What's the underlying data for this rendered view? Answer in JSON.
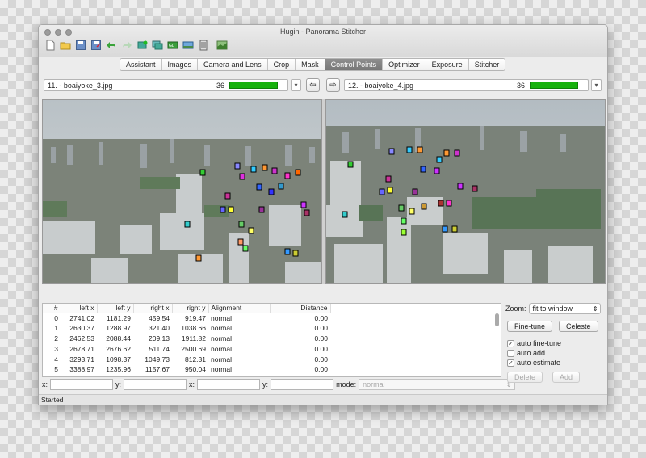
{
  "window": {
    "title": "Hugin - Panorama Stitcher"
  },
  "toolbar": {
    "icons": [
      "new-icon",
      "open-icon",
      "save-icon",
      "save-as-icon",
      "undo-icon",
      "redo-icon",
      "add-images-icon",
      "add-series-icon",
      "align-icon",
      "preview-icon",
      "fast-preview-icon",
      "layout-icon",
      "stitch-icon"
    ]
  },
  "tabs": [
    {
      "label": "Assistant",
      "active": false
    },
    {
      "label": "Images",
      "active": false
    },
    {
      "label": "Camera and Lens",
      "active": false
    },
    {
      "label": "Crop",
      "active": false
    },
    {
      "label": "Mask",
      "active": false
    },
    {
      "label": "Control Points",
      "active": true
    },
    {
      "label": "Optimizer",
      "active": false
    },
    {
      "label": "Exposure",
      "active": false
    },
    {
      "label": "Stitcher",
      "active": false
    }
  ],
  "left_image": {
    "name": "11. - boaiyoke_3.jpg",
    "count": "36"
  },
  "right_image": {
    "name": "12. - boaiyoke_4.jpg",
    "count": "36"
  },
  "table": {
    "headers": [
      "#",
      "left x",
      "left y",
      "right x",
      "right y",
      "Alignment",
      "Distance"
    ],
    "rows": [
      [
        "0",
        "2741.02",
        "1181.29",
        "459.54",
        "919.47",
        "normal",
        "0.00"
      ],
      [
        "1",
        "2630.37",
        "1288.97",
        "321.40",
        "1038.66",
        "normal",
        "0.00"
      ],
      [
        "2",
        "2462.53",
        "2088.44",
        "209.13",
        "1911.82",
        "normal",
        "0.00"
      ],
      [
        "3",
        "2678.71",
        "2676.62",
        "511.74",
        "2500.69",
        "normal",
        "0.00"
      ],
      [
        "4",
        "3293.71",
        "1098.37",
        "1049.73",
        "812.31",
        "normal",
        "0.00"
      ],
      [
        "5",
        "3388.97",
        "1235.96",
        "1157.67",
        "950.04",
        "normal",
        "0.00"
      ]
    ]
  },
  "coords": {
    "x_label": "x:",
    "y_label": "y:",
    "mode_label": "mode:",
    "mode_value": "normal"
  },
  "zoom": {
    "label": "Zoom:",
    "value": "fit to window"
  },
  "buttons": {
    "fine_tune": "Fine-tune",
    "celeste": "Celeste",
    "delete": "Delete",
    "add": "Add"
  },
  "options": {
    "auto_fine_tune": {
      "label": "auto fine-tune",
      "checked": true
    },
    "auto_add": {
      "label": "auto add",
      "checked": false
    },
    "auto_estimate": {
      "label": "auto estimate",
      "checked": true
    }
  },
  "status": "Started",
  "colors": {
    "progress_green": "#17b20d",
    "active_tab": "#808080"
  }
}
